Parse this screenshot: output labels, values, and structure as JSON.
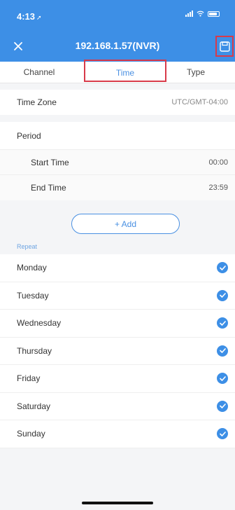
{
  "status_bar": {
    "time": "4:13",
    "location_arrow": "location-arrow-icon"
  },
  "header": {
    "title": "192.168.1.57(NVR)",
    "close_icon": "close-icon",
    "save_icon": "save-icon"
  },
  "tabs": [
    {
      "label": "Channel",
      "active": false
    },
    {
      "label": "Time",
      "active": true
    },
    {
      "label": "Type",
      "active": false
    }
  ],
  "time_zone": {
    "label": "Time Zone",
    "value": "UTC/GMT-04:00"
  },
  "period": {
    "label": "Period",
    "start": {
      "label": "Start Time",
      "value": "00:00"
    },
    "end": {
      "label": "End Time",
      "value": "23:59"
    }
  },
  "add_button": {
    "label": "+ Add"
  },
  "repeat": {
    "label": "Repeat",
    "days": [
      {
        "name": "Monday",
        "checked": true
      },
      {
        "name": "Tuesday",
        "checked": true
      },
      {
        "name": "Wednesday",
        "checked": true
      },
      {
        "name": "Thursday",
        "checked": true
      },
      {
        "name": "Friday",
        "checked": true
      },
      {
        "name": "Saturday",
        "checked": true
      },
      {
        "name": "Sunday",
        "checked": true
      }
    ]
  },
  "colors": {
    "header": "#3d8fe6",
    "accent": "#4a90e2",
    "highlight_box": "#d83a4a"
  }
}
